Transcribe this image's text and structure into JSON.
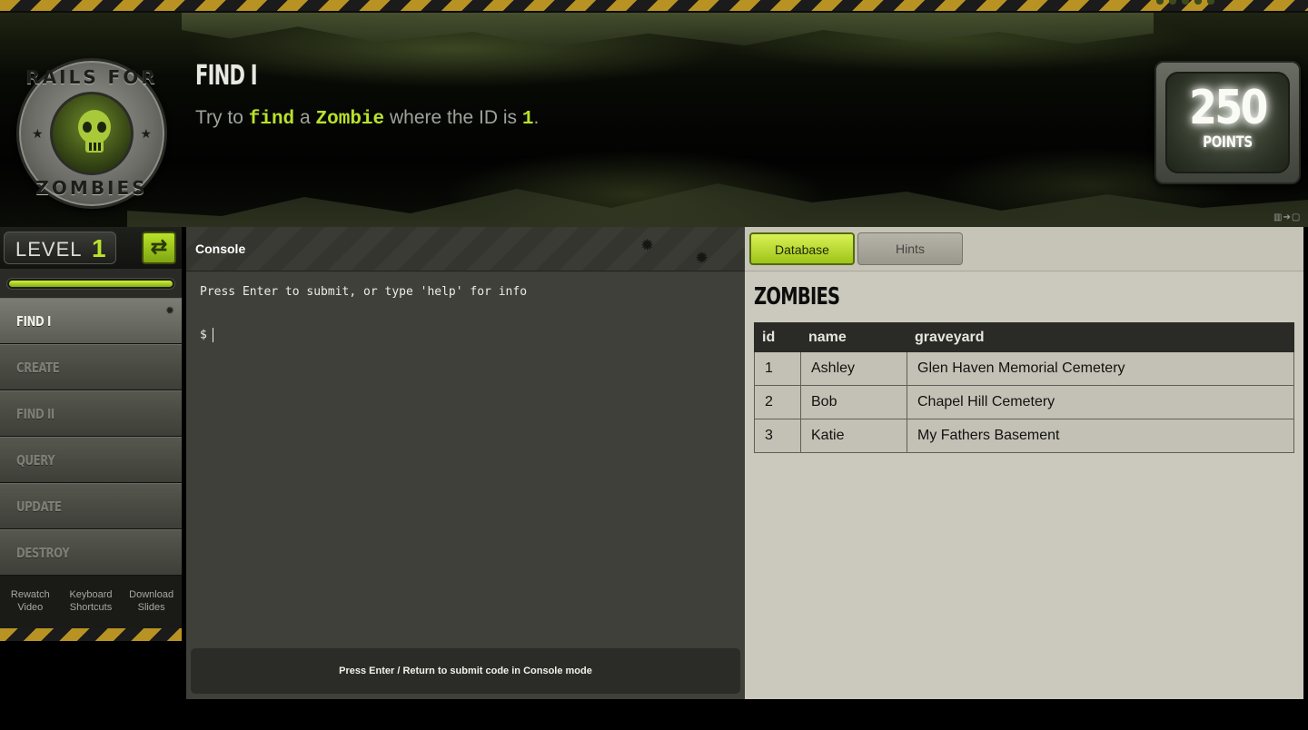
{
  "logo": {
    "top_text": "RAILS FOR",
    "bottom_text": "ZOMBIES"
  },
  "challenge": {
    "title": "FIND I",
    "instruction": [
      {
        "text": "Try to ",
        "code": false
      },
      {
        "text": "find",
        "code": true
      },
      {
        "text": " a ",
        "code": false
      },
      {
        "text": "Zombie",
        "code": true
      },
      {
        "text": " where the ID is ",
        "code": false
      },
      {
        "text": "1",
        "code": true
      },
      {
        "text": ".",
        "code": false
      }
    ]
  },
  "points": {
    "value": "250",
    "label": "POINTS"
  },
  "sidebar": {
    "level_label": "LEVEL",
    "level_number": "1",
    "switch_icon": "swap-arrows-icon",
    "progress": 1.0,
    "items": [
      {
        "label": "FIND I",
        "active": true
      },
      {
        "label": "CREATE",
        "active": false
      },
      {
        "label": "FIND II",
        "active": false
      },
      {
        "label": "QUERY",
        "active": false
      },
      {
        "label": "UPDATE",
        "active": false
      },
      {
        "label": "DESTROY",
        "active": false
      }
    ],
    "links": [
      {
        "label": "Rewatch\nVideo"
      },
      {
        "label": "Keyboard\nShortcuts"
      },
      {
        "label": "Download\nSlides"
      }
    ]
  },
  "console": {
    "title": "Console",
    "info": "Press Enter to submit, or type 'help' for info",
    "prompt": "$",
    "footer": "Press Enter / Return to submit code in Console mode"
  },
  "panel": {
    "tabs": [
      {
        "label": "Database",
        "active": true
      },
      {
        "label": "Hints",
        "active": false
      }
    ],
    "table_title": "ZOMBIES",
    "columns": [
      "id",
      "name",
      "graveyard"
    ],
    "rows": [
      [
        "1",
        "Ashley",
        "Glen Haven Memorial Cemetery"
      ],
      [
        "2",
        "Bob",
        "Chapel Hill Cemetery"
      ],
      [
        "3",
        "Katie",
        "My Fathers Basement"
      ]
    ]
  },
  "colors": {
    "accent": "#b9e22a",
    "hazard_yellow": "#b89323",
    "console_bg": "#3f403a",
    "panel_bg": "#cbc9bd"
  }
}
